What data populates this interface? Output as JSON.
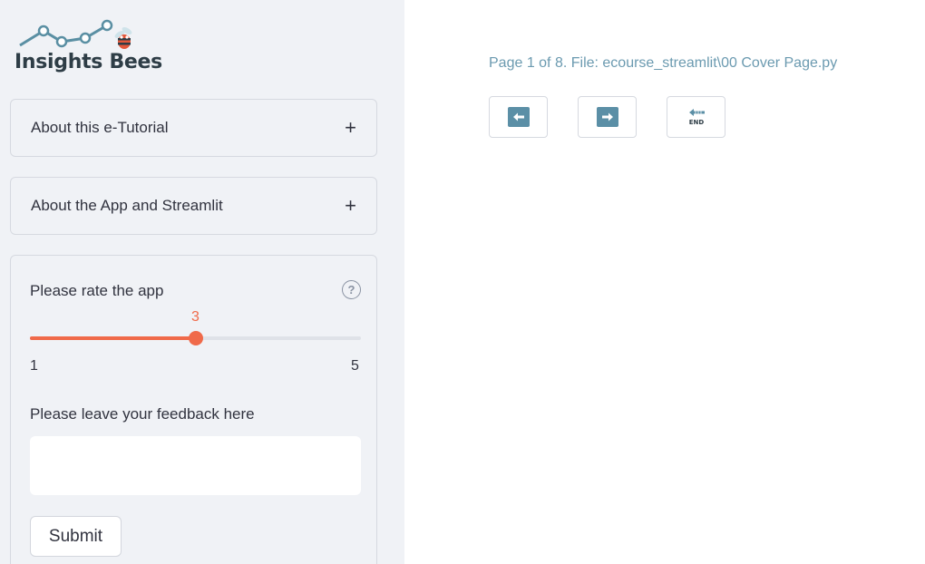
{
  "sidebar": {
    "logo_text": "Insights Bees",
    "expanders": [
      {
        "label": "About this e-Tutorial",
        "icon": "plus-icon"
      },
      {
        "label": "About the App and Streamlit",
        "icon": "plus-icon"
      }
    ],
    "form": {
      "rating_label": "Please rate the app",
      "rating_value": "3",
      "rating_min": "1",
      "rating_max": "5",
      "feedback_label": "Please leave your feedback here",
      "feedback_value": "",
      "submit_label": "Submit"
    }
  },
  "main": {
    "page_info": "Page 1 of 8. File: ecourse_streamlit\\00 Cover Page.py",
    "nav_buttons": [
      {
        "icon": "arrow-left-icon"
      },
      {
        "icon": "arrow-right-icon"
      },
      {
        "icon": "end-arrow-icon",
        "label": "END"
      }
    ]
  },
  "colors": {
    "accent": "#f06a4a",
    "sidebar_bg": "#f0f2f6",
    "page_info": "#6b9ab0",
    "nav_icon": "#5b8fa6"
  }
}
